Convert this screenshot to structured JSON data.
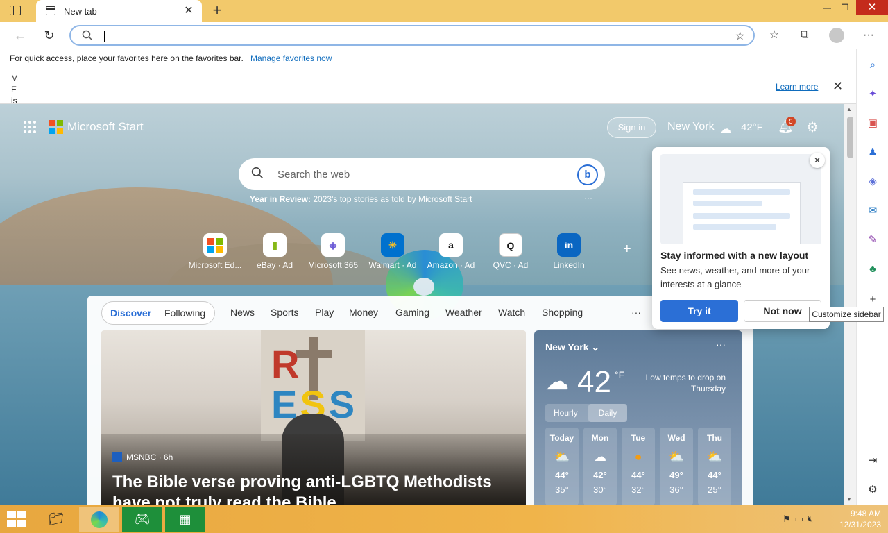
{
  "browser": {
    "tab_title": "New tab",
    "address_value": "",
    "favbar_text": "For quick access, place your favorites here on the favorites bar.",
    "favbar_link": "Manage favorites now",
    "notice_letters": "M\nE\nis",
    "learn_more": "Learn more"
  },
  "header": {
    "brand": "Microsoft Start",
    "sign_in": "Sign in",
    "city": "New York",
    "temp": "42°F",
    "notifications": "5"
  },
  "search": {
    "placeholder": "Search the web",
    "yir_bold": "Year in Review:",
    "yir_text": " 2023's top stories as told by Microsoft Start",
    "yir_more": "···"
  },
  "quick_links": [
    {
      "label": "Microsoft Ed...",
      "icon": "microsoft-edge-logo"
    },
    {
      "label": "eBay · Ad",
      "icon": "ebay-bag"
    },
    {
      "label": "Microsoft 365",
      "icon": "microsoft-365-logo"
    },
    {
      "label": "Walmart · Ad",
      "icon": "walmart-spark"
    },
    {
      "label": "Amazon · Ad",
      "icon": "amazon-a"
    },
    {
      "label": "QVC · Ad",
      "icon": "qvc-q"
    },
    {
      "label": "LinkedIn",
      "icon": "linkedin-in"
    }
  ],
  "feed": {
    "tab_discover": "Discover",
    "tab_following": "Following",
    "categories": [
      "News",
      "Sports",
      "Play",
      "Money",
      "Gaming",
      "Weather",
      "Watch",
      "Shopping"
    ],
    "more": "···"
  },
  "article": {
    "source": "MSNBC · 6h",
    "headline": "The Bible verse proving anti-LGBTQ Methodists have not truly read the Bible"
  },
  "weather": {
    "location": "New York",
    "menu": "···",
    "temp": "42",
    "unit": "°F",
    "alert": "Low temps to drop on Thursday",
    "seg_hourly": "Hourly",
    "seg_daily": "Daily",
    "days": [
      {
        "day": "Today",
        "icon": "partly-cloudy",
        "high": "44°",
        "low": "35°"
      },
      {
        "day": "Mon",
        "icon": "cloudy",
        "high": "42°",
        "low": "30°"
      },
      {
        "day": "Tue",
        "icon": "sunny",
        "high": "44°",
        "low": "32°"
      },
      {
        "day": "Wed",
        "icon": "partly-sunny",
        "high": "49°",
        "low": "36°"
      },
      {
        "day": "Thu",
        "icon": "partly-cloudy",
        "high": "44°",
        "low": "25°"
      }
    ]
  },
  "popup": {
    "title": "Stay informed with a new layout",
    "desc": "See news, weather, and more of your interests at a glance",
    "try": "Try it",
    "not_now": "Not now"
  },
  "sidebar_tooltip": "Customize sidebar",
  "clock": {
    "time": "9:48 AM",
    "date": "12/31/2023"
  }
}
